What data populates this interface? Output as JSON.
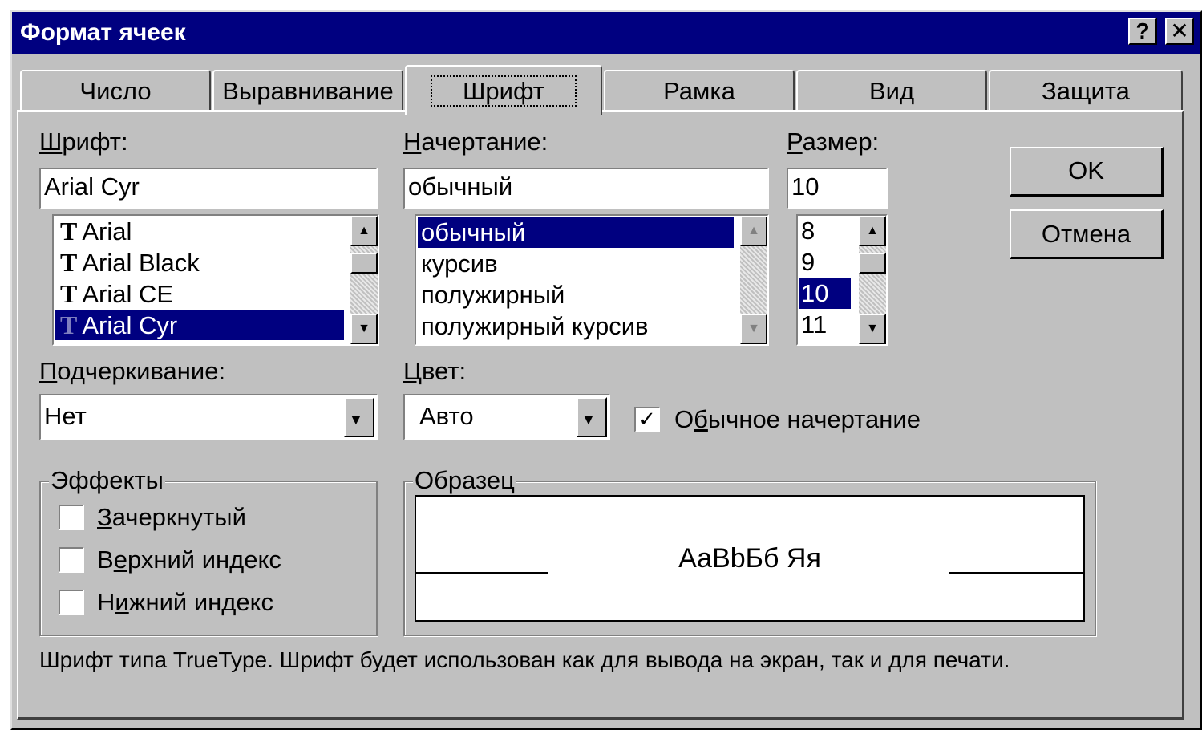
{
  "window": {
    "title": "Формат ячеек",
    "help_label": "?",
    "close_label": "✕"
  },
  "tabs": [
    {
      "label": "Число"
    },
    {
      "label": "Выравнивание"
    },
    {
      "label": "Шрифт"
    },
    {
      "label": "Рамка"
    },
    {
      "label": "Вид"
    },
    {
      "label": "Защита"
    }
  ],
  "font": {
    "label_accel": "Ш",
    "label_rest": "рифт:",
    "value": "Arial Cyr",
    "items": [
      "Arial",
      "Arial Black",
      "Arial CE",
      "Arial Cyr"
    ],
    "selected_index": 3
  },
  "style": {
    "label_accel": "Н",
    "label_rest": "ачертание:",
    "value": "обычный",
    "items": [
      "обычный",
      "курсив",
      "полужирный",
      "полужирный курсив"
    ],
    "selected_index": 0
  },
  "size": {
    "label_accel": "Р",
    "label_rest": "азмер:",
    "value": "10",
    "items": [
      "8",
      "9",
      "10",
      "11"
    ],
    "selected_index": 2
  },
  "underline": {
    "label_accel": "П",
    "label_rest": "одчеркивание:",
    "value": "Нет"
  },
  "color": {
    "label_accel": "Ц",
    "label_rest": "вет:",
    "value": "Авто"
  },
  "normal_style": {
    "checked": true,
    "check_mark": "✓",
    "label_pre": "О",
    "label_accel": "б",
    "label_rest": "ычное начертание"
  },
  "effects": {
    "title": "Эффекты",
    "items": [
      {
        "pre": "",
        "accel": "З",
        "rest": "ачеркнутый",
        "checked": false
      },
      {
        "pre": "В",
        "accel": "е",
        "rest": "рхний индекс",
        "checked": false
      },
      {
        "pre": "Н",
        "accel": "и",
        "rest": "жний индекс",
        "checked": false
      }
    ]
  },
  "sample": {
    "title": "Образец",
    "text": "АаBbБб Яя"
  },
  "buttons": {
    "ok": "OK",
    "cancel": "Отмена"
  },
  "icons": {
    "truetype": "truetype-font-icon",
    "tt_glyph": "T",
    "arrow_up": "▲",
    "arrow_down": "▼"
  },
  "footer": "Шрифт типа TrueType. Шрифт будет использован как для вывода на экран, так и для печати."
}
